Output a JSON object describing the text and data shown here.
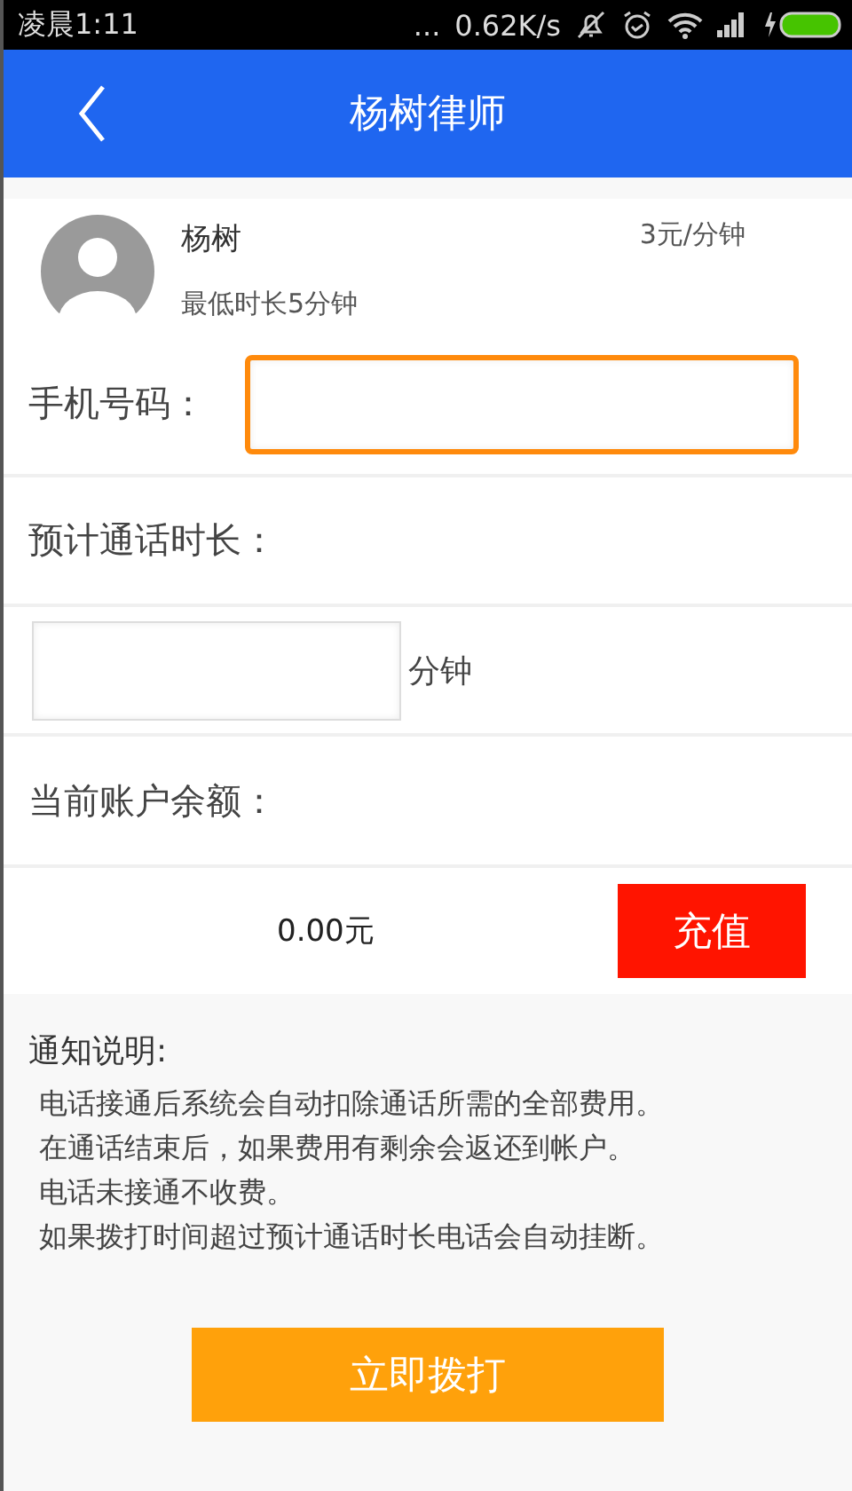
{
  "status_bar": {
    "time": "凌晨1:11",
    "dots": "...",
    "speed": "0.62K/s"
  },
  "header": {
    "title": "杨树律师"
  },
  "lawyer": {
    "name": "杨树",
    "price": "3元/分钟",
    "minimum": "最低时长5分钟"
  },
  "phone": {
    "label": "手机号码：",
    "focused": true
  },
  "duration": {
    "label": "预计通话时长：",
    "unit": "分钟",
    "focused": false
  },
  "balance": {
    "label": "当前账户余额：",
    "amount": "0.00元",
    "recharge_button": "充值"
  },
  "notice": {
    "title": "通知说明:",
    "lines": [
      "电话接通后系统会自动扣除通话所需的全部费用。",
      "在通话结束后，如果费用有剩余会返还到帐户。",
      "电话未接通不收费。",
      "如果拨打时间超过预计通话时长电话会自动挂断。"
    ]
  },
  "call_button": "立即拨打"
}
